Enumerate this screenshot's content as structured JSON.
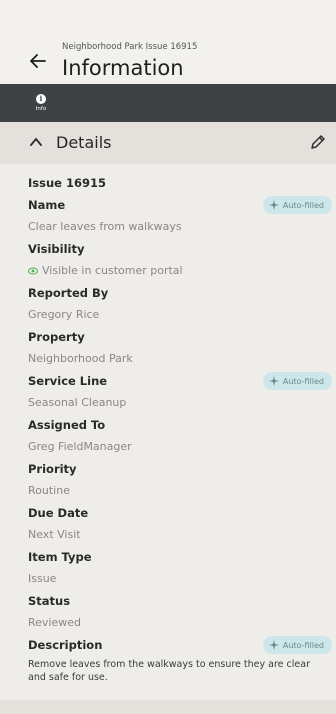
{
  "header": {
    "subtitle": "Neighborhood Park Issue 16915",
    "title": "Information",
    "back_icon": "arrow-left-icon"
  },
  "tabs": [
    {
      "label": "Info",
      "icon": "info-icon"
    }
  ],
  "section": {
    "title": "Details",
    "edit_icon": "pencil-icon"
  },
  "details": {
    "issue_id": "Issue 16915",
    "name_label": "Name",
    "name_value": "Clear leaves from walkways",
    "visibility_label": "Visibility",
    "visibility_value": "Visible in customer portal",
    "reported_by_label": "Reported By",
    "reported_by_value": "Gregory Rice",
    "property_label": "Property",
    "property_value": "Neighborhood Park",
    "service_line_label": "Service Line",
    "service_line_value": "Seasonal Cleanup",
    "assigned_to_label": "Assigned To",
    "assigned_to_value": "Greg FieldManager",
    "priority_label": "Priority",
    "priority_value": "Routine",
    "due_date_label": "Due Date",
    "due_date_value": "Next Visit",
    "item_type_label": "Item Type",
    "item_type_value": "Issue",
    "status_label": "Status",
    "status_value": "Reviewed",
    "description_label": "Description",
    "description_value": "Remove leaves from the walkways to ensure they are clear and safe for use."
  },
  "chip": {
    "label": "Auto-filled"
  },
  "colors": {
    "tabbar": "#3f4245",
    "chip_bg": "#cde6ea",
    "visibility_green": "#4caf50"
  }
}
